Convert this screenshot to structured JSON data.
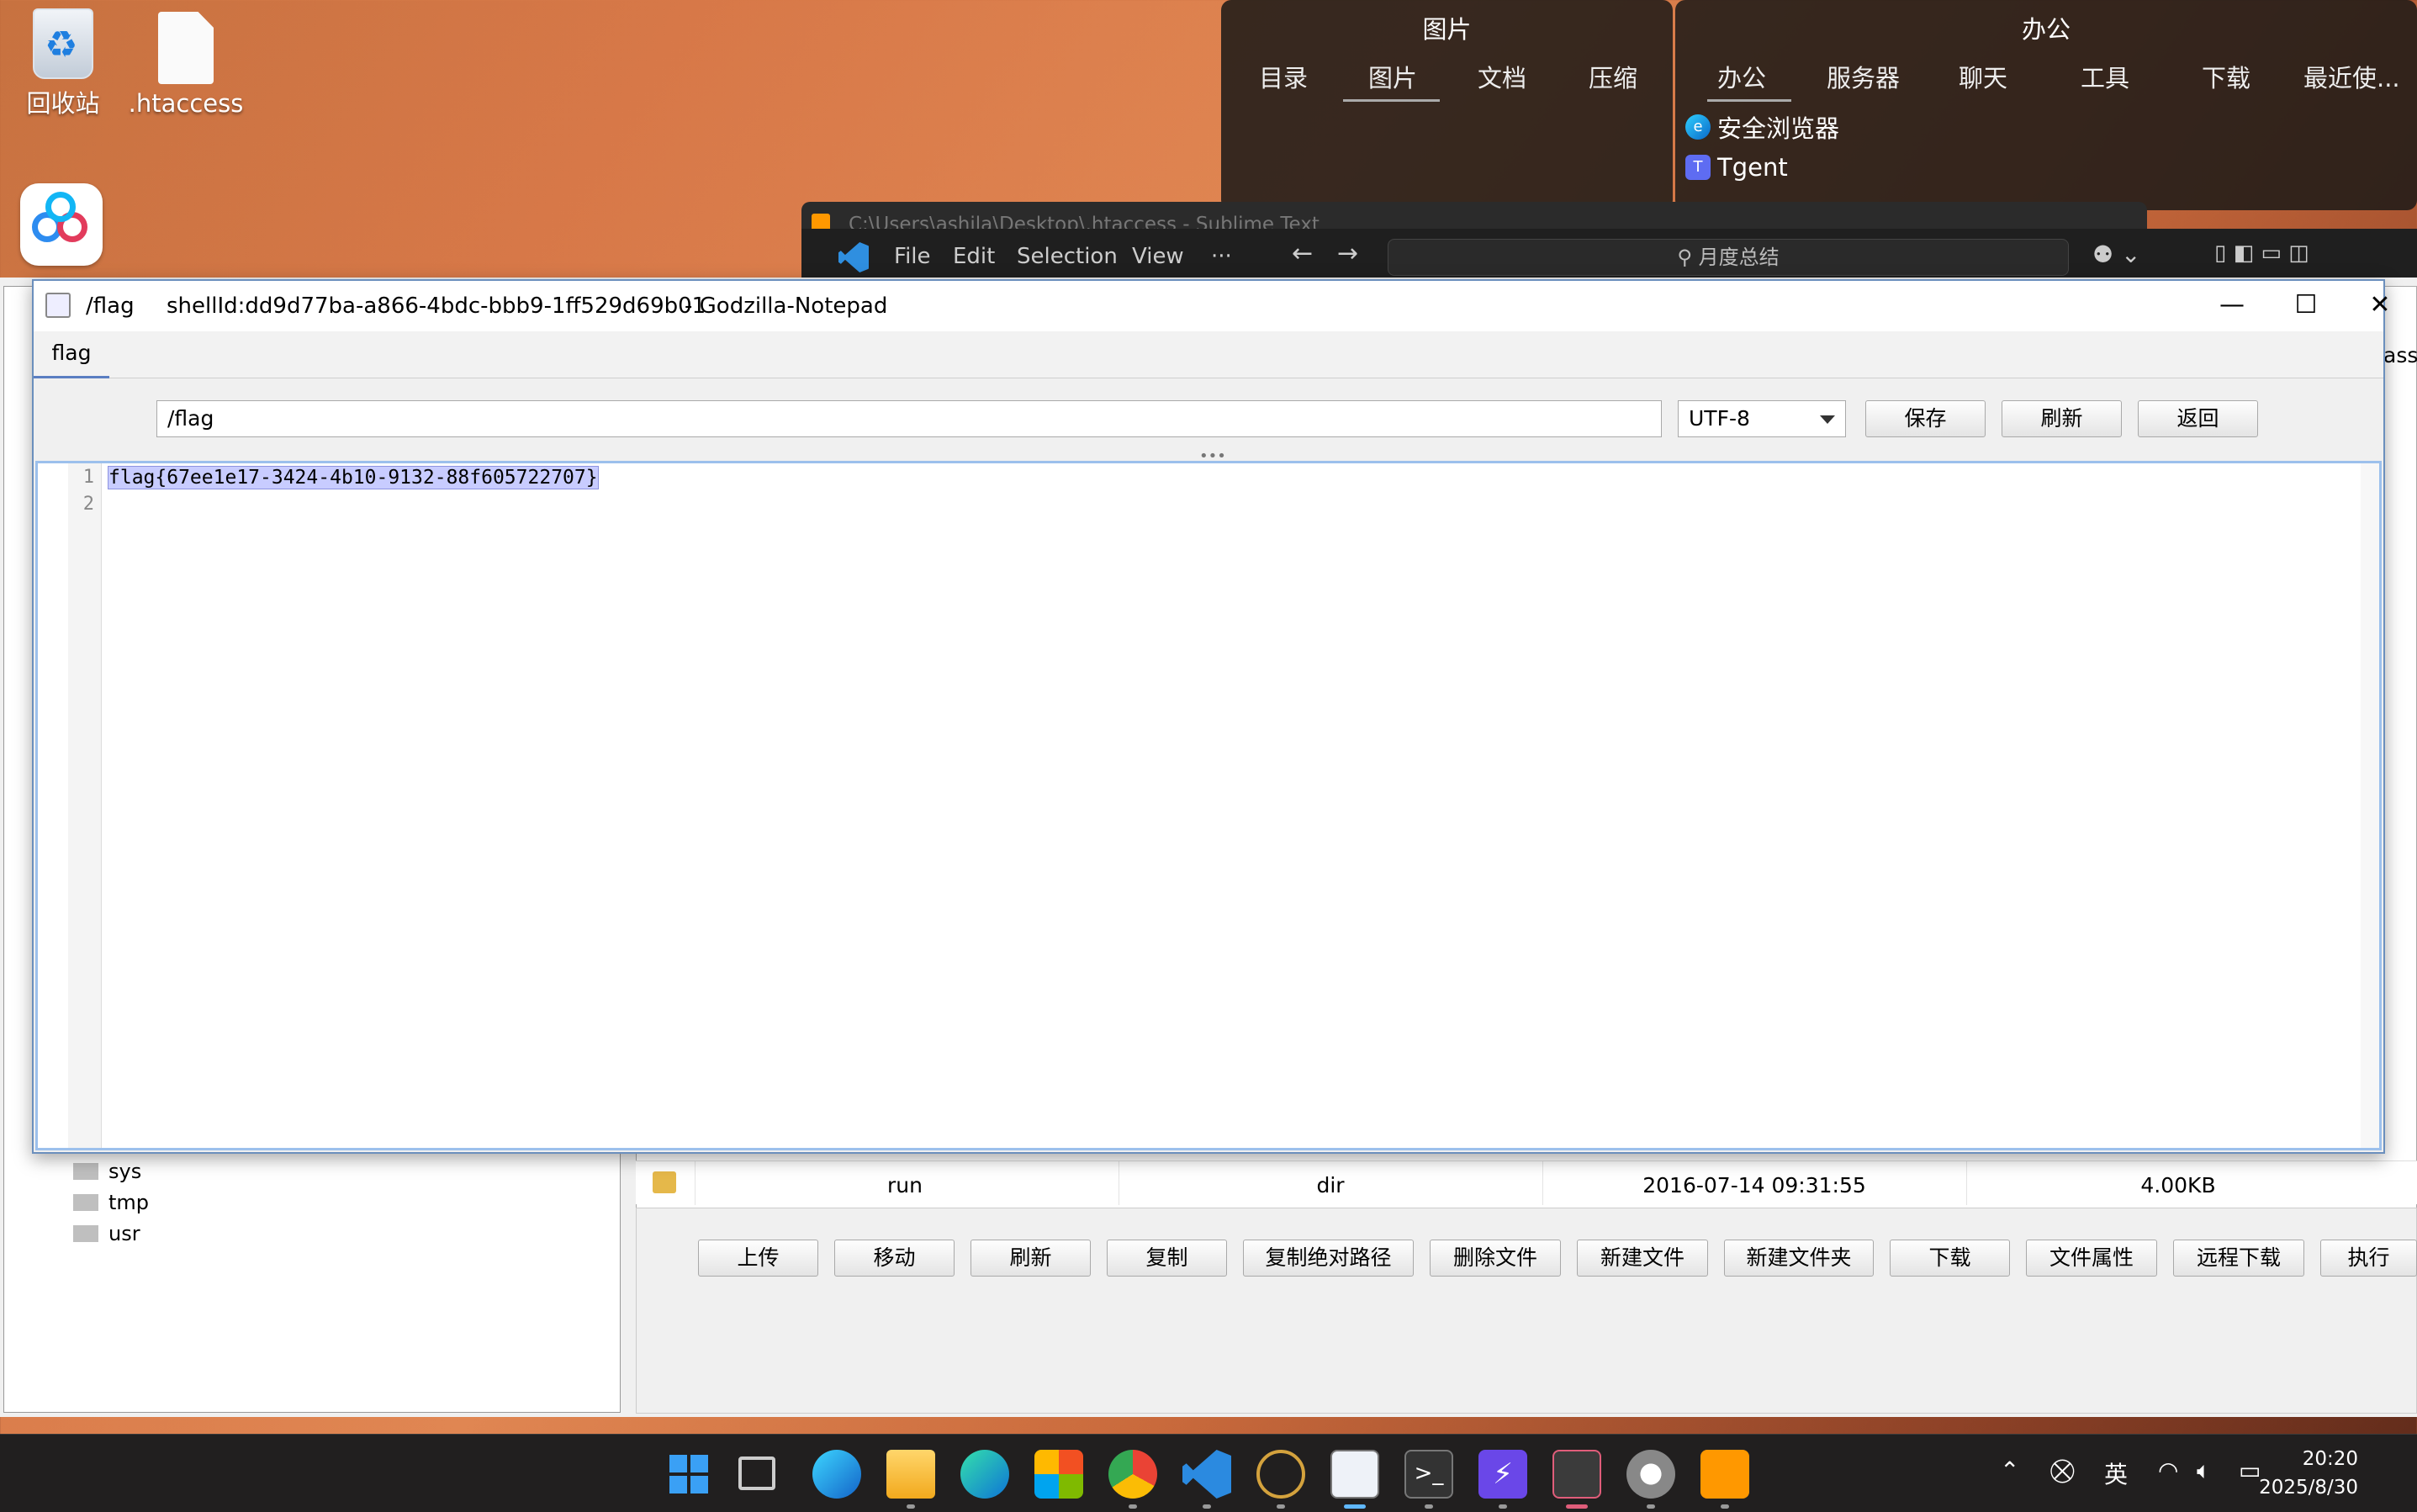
{
  "desktop": {
    "icons": [
      {
        "label": "回收站",
        "icon": "recycle-bin-icon"
      },
      {
        "label": ".htaccess",
        "icon": "file-icon"
      }
    ]
  },
  "widgets": {
    "images": {
      "title": "图片",
      "tabs": [
        "目录",
        "图片",
        "文档",
        "压缩"
      ],
      "selected": "图片"
    },
    "office": {
      "title": "办公",
      "tabs": [
        "办公",
        "服务器",
        "聊天",
        "工具",
        "下载",
        "最近使..."
      ],
      "selected": "办公",
      "apps": [
        {
          "label": "安全浏览器",
          "icon": "edge-icon"
        },
        {
          "label": "Tgent",
          "icon": "tgent-icon"
        }
      ]
    }
  },
  "vscode": {
    "menu": [
      "File",
      "Edit",
      "Selection",
      "View",
      "···"
    ],
    "search_placeholder": "月度总结"
  },
  "sublime": {
    "title": "C:\\Users\\ashila\\Desktop\\.htaccess - Sublime Text"
  },
  "notepad": {
    "title_path": "/flag",
    "shell_id": "shellId:dd9d77ba-a866-4bdc-bbb9-1ff529d69b01",
    "app": "- Godzilla-Notepad",
    "tab": "flag",
    "path_value": "/flag",
    "encoding": "UTF-8",
    "buttons": {
      "save": "保存",
      "refresh": "刷新",
      "back": "返回"
    },
    "lines": [
      "flag{67ee1e17-3424-4b10-9132-88f605722707}",
      ""
    ],
    "line_numbers": [
      "1",
      "2"
    ]
  },
  "tree": {
    "items": [
      "sys",
      "tmp",
      "usr"
    ]
  },
  "file_table": {
    "row": {
      "name": "run",
      "type": "dir",
      "date": "2016-07-14 09:31:55",
      "size": "4.00KB"
    }
  },
  "actions": [
    "上传",
    "移动",
    "刷新",
    "复制",
    "复制绝对路径",
    "删除文件",
    "新建文件",
    "新建文件夹",
    "下载",
    "文件属性",
    "远程下载",
    "执行"
  ],
  "edge_text": "assL",
  "taskbar": {
    "apps": [
      "windows-start-icon",
      "task-view-icon",
      "edge-beta-icon",
      "file-explorer-icon",
      "edge-icon",
      "store-icon",
      "chrome-icon",
      "vscode-icon",
      "burp-icon",
      "java-icon",
      "terminal-icon",
      "tool-icon",
      "qq-icon",
      "game-icon",
      "sublime-icon"
    ],
    "ime": "英",
    "time": "20:20",
    "date": "2025/8/30"
  }
}
